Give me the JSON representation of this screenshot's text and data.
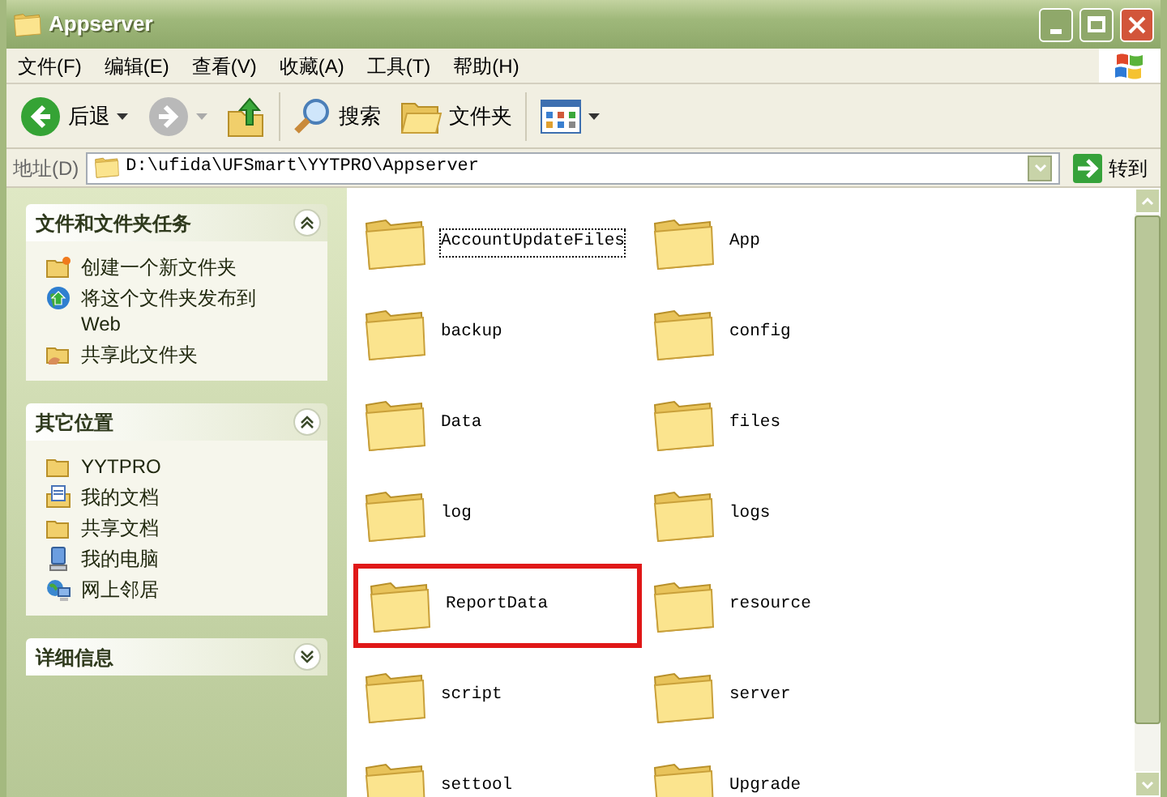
{
  "window": {
    "title": "Appserver"
  },
  "menu": [
    "文件(F)",
    "编辑(E)",
    "查看(V)",
    "收藏(A)",
    "工具(T)",
    "帮助(H)"
  ],
  "toolbar": [
    {
      "kind": "back",
      "label": "后退",
      "disabled": false
    },
    {
      "kind": "forward",
      "disabled": true
    },
    {
      "kind": "up",
      "disabled": false
    },
    {
      "kind": "search",
      "label": "搜索",
      "disabled": false
    },
    {
      "kind": "folders",
      "label": "文件夹",
      "disabled": false
    },
    {
      "kind": "views",
      "disabled": false
    }
  ],
  "address": {
    "label": "地址(D)",
    "value": "D:\\ufida\\UFSmart\\YYTPRO\\Appserver",
    "go": "转到"
  },
  "sidebar": [
    {
      "title": "文件和文件夹任务",
      "expanded": true,
      "items": [
        {
          "kind": "new-folder",
          "label": "创建一个新文件夹"
        },
        {
          "kind": "publish",
          "label": "将这个文件夹发布到 Web"
        },
        {
          "kind": "share",
          "label": "共享此文件夹"
        }
      ]
    },
    {
      "title": "其它位置",
      "expanded": true,
      "items": [
        {
          "kind": "folder",
          "label": "YYTPRO"
        },
        {
          "kind": "documents",
          "label": "我的文档"
        },
        {
          "kind": "folder",
          "label": "共享文档"
        },
        {
          "kind": "computer",
          "label": "我的电脑"
        },
        {
          "kind": "network",
          "label": "网上邻居"
        }
      ]
    },
    {
      "title": "详细信息",
      "expanded": false
    }
  ],
  "files": [
    {
      "name": "AccountUpdateFiles",
      "focused": true,
      "highlighted": false
    },
    {
      "name": "App",
      "focused": false,
      "highlighted": false
    },
    {
      "name": "backup",
      "focused": false,
      "highlighted": false
    },
    {
      "name": "config",
      "focused": false,
      "highlighted": false
    },
    {
      "name": "Data",
      "focused": false,
      "highlighted": false
    },
    {
      "name": "files",
      "focused": false,
      "highlighted": false
    },
    {
      "name": "log",
      "focused": false,
      "highlighted": false
    },
    {
      "name": "logs",
      "focused": false,
      "highlighted": false
    },
    {
      "name": "ReportData",
      "focused": false,
      "highlighted": true
    },
    {
      "name": "resource",
      "focused": false,
      "highlighted": false
    },
    {
      "name": "script",
      "focused": false,
      "highlighted": false
    },
    {
      "name": "server",
      "focused": false,
      "highlighted": false
    },
    {
      "name": "settool",
      "focused": false,
      "highlighted": false
    },
    {
      "name": "Upgrade",
      "focused": false,
      "highlighted": false
    }
  ]
}
